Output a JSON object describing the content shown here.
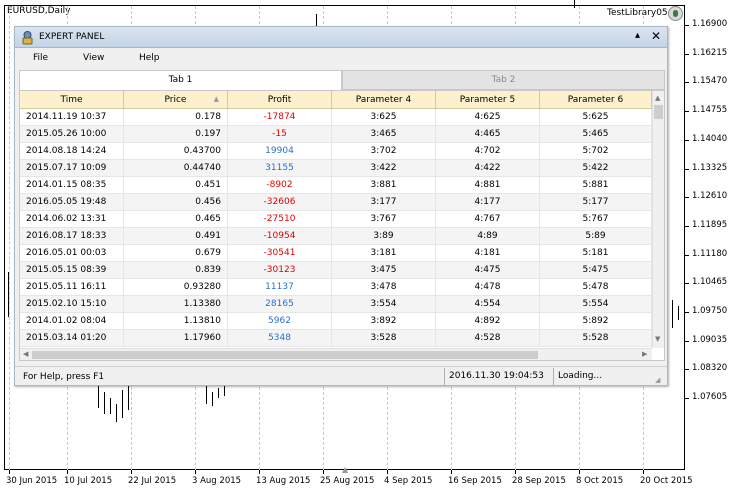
{
  "chart": {
    "symbol": "EURUSD,Daily",
    "expert": "TestLibrary05",
    "smiley_icon": "smiley-icon",
    "price_labels": [
      "1.16900",
      "1.16215",
      "1.15470",
      "1.14755",
      "1.14040",
      "1.13325",
      "1.12610",
      "1.11895",
      "1.11180",
      "1.10465",
      "1.09750",
      "1.09035",
      "1.08320",
      "1.07605"
    ],
    "date_labels": [
      "30 Jun 2015",
      "10 Jul 2015",
      "22 Jul 2015",
      "3 Aug 2015",
      "13 Aug 2015",
      "25 Aug 2015",
      "4 Sep 2015",
      "16 Sep 2015",
      "28 Sep 2015",
      "8 Oct 2015",
      "20 Oct 2015"
    ]
  },
  "panel": {
    "title": "EXPERT PANEL",
    "min_label": "▴",
    "close_label": "✕",
    "menu": [
      "File",
      "View",
      "Help"
    ],
    "tabs": [
      {
        "label": "Tab 1"
      },
      {
        "label": "Tab 2"
      }
    ],
    "columns": [
      "Time",
      "Price",
      "Profit",
      "Parameter 4",
      "Parameter 5",
      "Parameter 6"
    ],
    "rows": [
      {
        "time": "2014.11.19 10:37",
        "price": "0.178",
        "profit": "-17874",
        "p4": "3:625",
        "p5": "4:625",
        "p6": "5:625"
      },
      {
        "time": "2015.05.26 10:00",
        "price": "0.197",
        "profit": "-15",
        "p4": "3:465",
        "p5": "4:465",
        "p6": "5:465"
      },
      {
        "time": "2014.08.18 14:24",
        "price": "0.43700",
        "profit": "19904",
        "p4": "3:702",
        "p5": "4:702",
        "p6": "5:702"
      },
      {
        "time": "2015.07.17 10:09",
        "price": "0.44740",
        "profit": "31155",
        "p4": "3:422",
        "p5": "4:422",
        "p6": "5:422"
      },
      {
        "time": "2014.01.15 08:35",
        "price": "0.451",
        "profit": "-8902",
        "p4": "3:881",
        "p5": "4:881",
        "p6": "5:881"
      },
      {
        "time": "2016.05.05 19:48",
        "price": "0.456",
        "profit": "-32606",
        "p4": "3:177",
        "p5": "4:177",
        "p6": "5:177"
      },
      {
        "time": "2014.06.02 13:31",
        "price": "0.465",
        "profit": "-27510",
        "p4": "3:767",
        "p5": "4:767",
        "p6": "5:767"
      },
      {
        "time": "2016.08.17 18:33",
        "price": "0.491",
        "profit": "-10954",
        "p4": "3:89",
        "p5": "4:89",
        "p6": "5:89"
      },
      {
        "time": "2016.05.01 00:03",
        "price": "0.679",
        "profit": "-30541",
        "p4": "3:181",
        "p5": "4:181",
        "p6": "5:181"
      },
      {
        "time": "2015.05.15 08:39",
        "price": "0.839",
        "profit": "-30123",
        "p4": "3:475",
        "p5": "4:475",
        "p6": "5:475"
      },
      {
        "time": "2015.05.11 16:11",
        "price": "0.93280",
        "profit": "11137",
        "p4": "3:478",
        "p5": "4:478",
        "p6": "5:478"
      },
      {
        "time": "2015.02.10 15:10",
        "price": "1.13380",
        "profit": "28165",
        "p4": "3:554",
        "p5": "4:554",
        "p6": "5:554"
      },
      {
        "time": "2014.01.02 08:04",
        "price": "1.13810",
        "profit": "5962",
        "p4": "3:892",
        "p5": "4:892",
        "p6": "5:892"
      },
      {
        "time": "2015.03.14 01:20",
        "price": "1.17960",
        "profit": "5348",
        "p4": "3:528",
        "p5": "4:528",
        "p6": "5:528"
      }
    ],
    "status": {
      "help": "For Help, press F1",
      "datetime": "2016.11.30 19:04:53",
      "loading": "Loading..."
    }
  }
}
